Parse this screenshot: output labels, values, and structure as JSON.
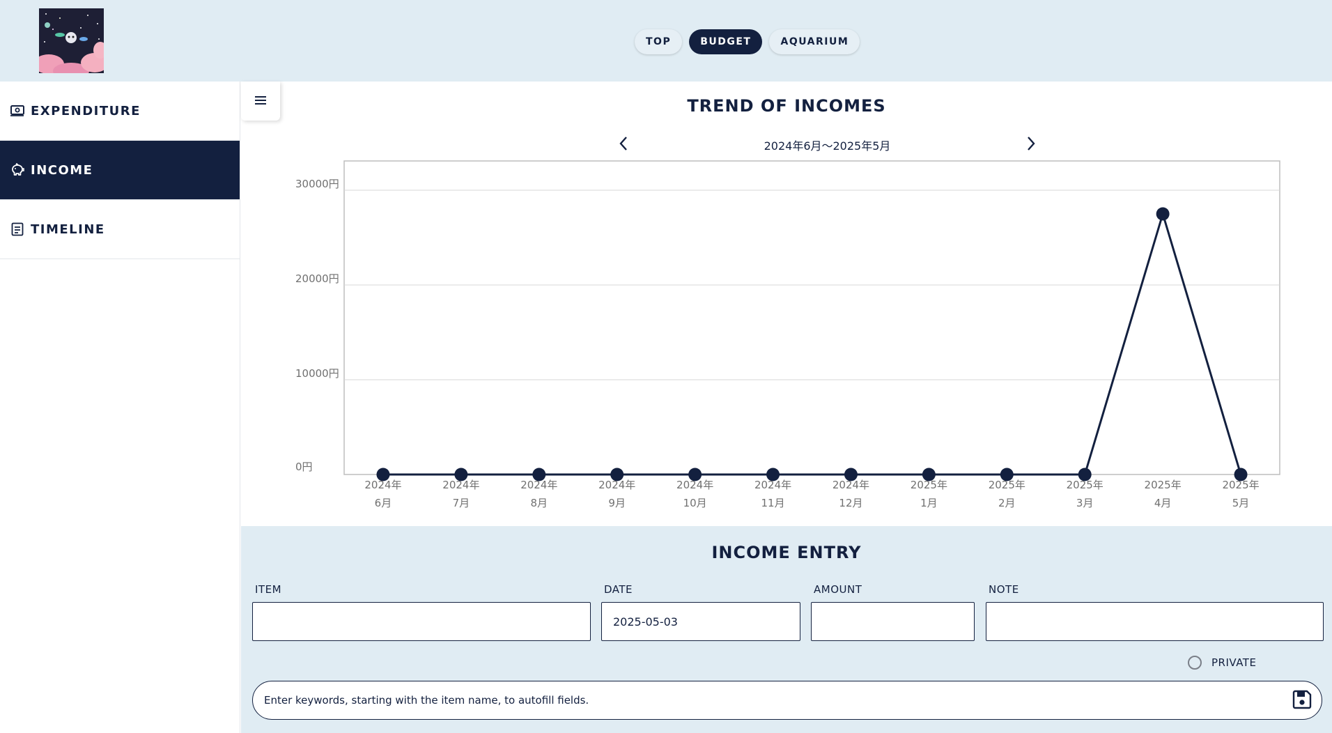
{
  "nav": {
    "items": [
      {
        "label": "TOP"
      },
      {
        "label": "BUDGET"
      },
      {
        "label": "AQUARIUM"
      }
    ]
  },
  "sidebar": {
    "items": [
      {
        "label": "EXPENDITURE"
      },
      {
        "label": "INCOME"
      },
      {
        "label": "TIMELINE"
      }
    ]
  },
  "chart_section": {
    "title": "TREND OF INCOMES",
    "period": "2024年6月〜2025年5月"
  },
  "chart_data": {
    "type": "line",
    "title": "TREND OF INCOMES",
    "categories": [
      "2024年\n6月",
      "2024年\n7月",
      "2024年\n8月",
      "2024年\n9月",
      "2024年\n10月",
      "2024年\n11月",
      "2024年\n12月",
      "2025年\n1月",
      "2025年\n2月",
      "2025年\n3月",
      "2025年\n4月",
      "2025年\n5月"
    ],
    "series": [
      {
        "values": [
          0,
          0,
          0,
          0,
          0,
          0,
          0,
          0,
          0,
          0,
          27500,
          0
        ],
        "color": "#13203f"
      }
    ],
    "yticks": [
      "0円",
      "10000円",
      "20000円",
      "30000円"
    ],
    "ylim": [
      0,
      33000
    ],
    "grid": true
  },
  "entry": {
    "title": "INCOME ENTRY",
    "item_label": "ITEM",
    "item_value": "",
    "date_label": "DATE",
    "date_value": "2025-05-03",
    "amount_label": "AMOUNT",
    "amount_value": "",
    "note_label": "NOTE",
    "note_value": "",
    "private_label": "PRIVATE",
    "autofill_placeholder": "Enter keywords, starting with the item name, to autofill fields."
  },
  "icons": {
    "menu": "hamburger-icon",
    "prev": "chevron-left-icon",
    "next": "chevron-right-icon",
    "save": "floppy-disk-icon"
  },
  "colors": {
    "navy": "#13203f",
    "light_bg": "#e0ecf3"
  }
}
